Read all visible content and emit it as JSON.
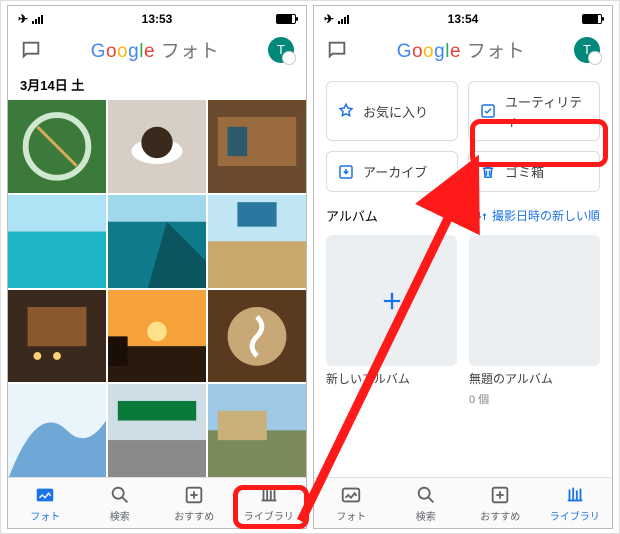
{
  "left": {
    "time": "13:53",
    "app_title_suffix": "フォト",
    "avatar_initial": "T",
    "date_header": "3月14日 土",
    "tabs": [
      {
        "label": "フォト"
      },
      {
        "label": "検索"
      },
      {
        "label": "おすすめ"
      },
      {
        "label": "ライブラリ"
      }
    ]
  },
  "right": {
    "time": "13:54",
    "app_title_suffix": "フォト",
    "avatar_initial": "T",
    "chips": [
      {
        "label": "お気に入り"
      },
      {
        "label": "ユーティリティ"
      },
      {
        "label": "アーカイブ"
      },
      {
        "label": "ゴミ箱"
      }
    ],
    "section_title": "アルバム",
    "sort_label": "撮影日時の新しい順",
    "albums": [
      {
        "label": "新しいアルバム",
        "sub": ""
      },
      {
        "label": "無題のアルバム",
        "sub": "0 個"
      }
    ],
    "tabs": [
      {
        "label": "フォト"
      },
      {
        "label": "検索"
      },
      {
        "label": "おすすめ"
      },
      {
        "label": "ライブラリ"
      }
    ]
  }
}
